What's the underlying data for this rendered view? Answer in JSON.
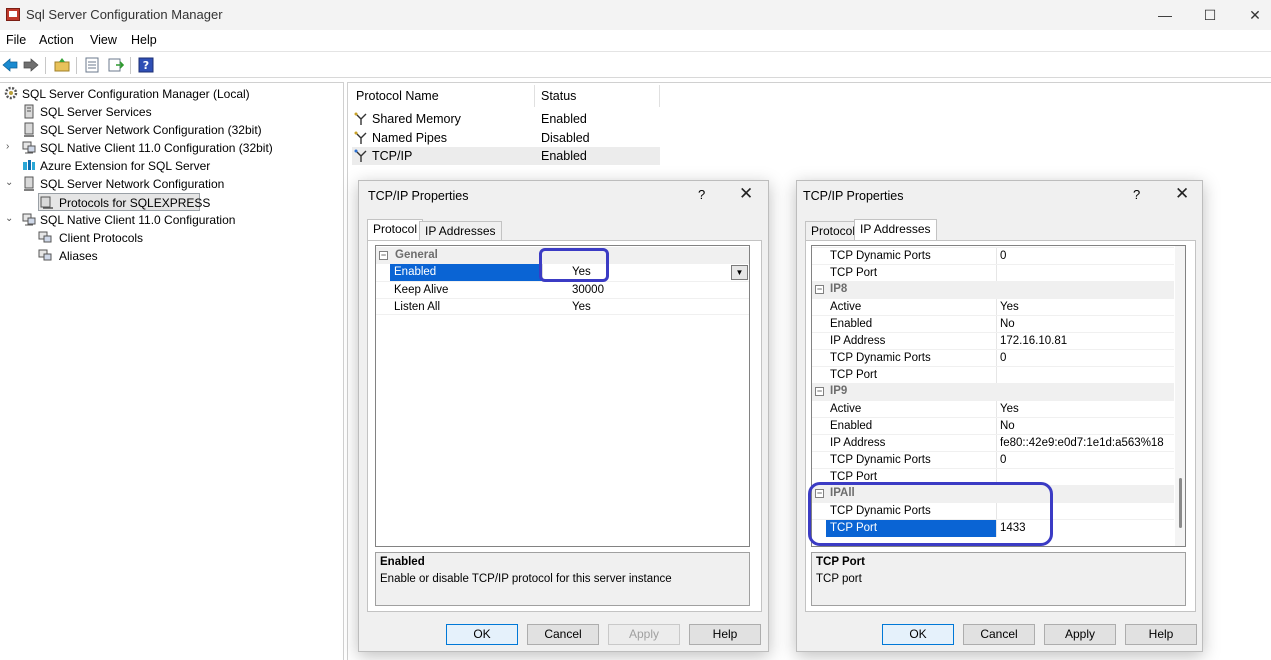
{
  "window": {
    "title": "Sql Server Configuration Manager"
  },
  "menu": [
    "File",
    "Action",
    "View",
    "Help"
  ],
  "tree": {
    "root": "SQL Server Configuration Manager (Local)",
    "items": [
      "SQL Server Services",
      "SQL Server Network Configuration (32bit)",
      "SQL Native Client 11.0 Configuration (32bit)",
      "Azure Extension for SQL Server",
      "SQL Server Network Configuration",
      "Protocols for SQLEXPRESS",
      "SQL Native Client 11.0 Configuration",
      "Client Protocols",
      "Aliases"
    ]
  },
  "list": {
    "col_protocol": "Protocol Name",
    "col_status": "Status",
    "rows": [
      {
        "name": "Shared Memory",
        "status": "Enabled"
      },
      {
        "name": "Named Pipes",
        "status": "Disabled"
      },
      {
        "name": "TCP/IP",
        "status": "Enabled"
      }
    ]
  },
  "dialog1": {
    "title": "TCP/IP Properties",
    "help": "?",
    "close": "✕",
    "tabs": [
      "Protocol",
      "IP Addresses"
    ],
    "category": "General",
    "collapse": "−",
    "rows": [
      {
        "name": "Enabled",
        "value": "Yes"
      },
      {
        "name": "Keep Alive",
        "value": "30000"
      },
      {
        "name": "Listen All",
        "value": "Yes"
      }
    ],
    "desc_title": "Enabled",
    "desc_text": "Enable or disable TCP/IP protocol for this server instance",
    "buttons": {
      "ok": "OK",
      "cancel": "Cancel",
      "apply": "Apply",
      "help": "Help"
    }
  },
  "dialog2": {
    "title": "TCP/IP Properties",
    "help": "?",
    "close": "✕",
    "tabs": [
      "Protocol",
      "IP Addresses"
    ],
    "collapse": "−",
    "rows": [
      {
        "name": "TCP Dynamic Ports",
        "value": "0"
      },
      {
        "name": "TCP Port",
        "value": ""
      },
      {
        "name": "IP8",
        "value": "",
        "cat": true
      },
      {
        "name": "Active",
        "value": "Yes"
      },
      {
        "name": "Enabled",
        "value": "No"
      },
      {
        "name": "IP Address",
        "value": "172.16.10.81"
      },
      {
        "name": "TCP Dynamic Ports",
        "value": "0"
      },
      {
        "name": "TCP Port",
        "value": ""
      },
      {
        "name": "IP9",
        "value": "",
        "cat": true
      },
      {
        "name": "Active",
        "value": "Yes"
      },
      {
        "name": "Enabled",
        "value": "No"
      },
      {
        "name": "IP Address",
        "value": "fe80::42e9:e0d7:1e1d:a563%18"
      },
      {
        "name": "TCP Dynamic Ports",
        "value": "0"
      },
      {
        "name": "TCP Port",
        "value": ""
      },
      {
        "name": "IPAll",
        "value": "",
        "cat": true
      },
      {
        "name": "TCP Dynamic Ports",
        "value": ""
      },
      {
        "name": "TCP Port",
        "value": "1433",
        "selected": true
      }
    ],
    "desc_title": "TCP Port",
    "desc_text": "TCP port",
    "buttons": {
      "ok": "OK",
      "cancel": "Cancel",
      "apply": "Apply",
      "help": "Help"
    }
  },
  "colors": {
    "annotation": "#3b3bc4",
    "selection": "#0a64d4"
  },
  "icons": [
    "back-arrow-icon",
    "forward-arrow-icon",
    "up-folder-icon",
    "properties-icon",
    "export-list-icon",
    "help-icon"
  ]
}
